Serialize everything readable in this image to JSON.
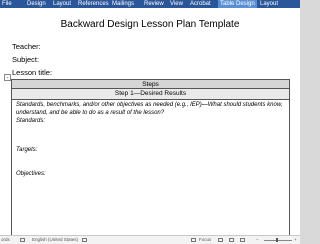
{
  "ribbon": {
    "tabs": [
      {
        "label": "File"
      },
      {
        "label": "Design"
      },
      {
        "label": "Layout"
      },
      {
        "label": "References"
      },
      {
        "label": "Mailings"
      },
      {
        "label": "Review"
      },
      {
        "label": "View"
      },
      {
        "label": "Acrobat"
      },
      {
        "label": "Table Design"
      },
      {
        "label": "Layout"
      }
    ]
  },
  "document": {
    "title": "Backward Design Lesson Plan Template",
    "fields": {
      "teacher": "Teacher:",
      "subject": "Subject:",
      "lesson_title": "Lesson title:"
    },
    "move_handle_glyph": "+",
    "table": {
      "header": "Steps",
      "step1": "Step 1—Desired Results",
      "prompt_line1": "Standards, benchmarks, and/or other objectives as needed (e.g., IEP)—What should students know,",
      "prompt_line2": "understand, and be able to do as a result of the lesson?",
      "standards": "Standards:",
      "targets": "Targets:",
      "objectives": "Objectives:"
    }
  },
  "status_bar": {
    "words": "ords",
    "language": "English (United States)",
    "focus": "Focus"
  }
}
